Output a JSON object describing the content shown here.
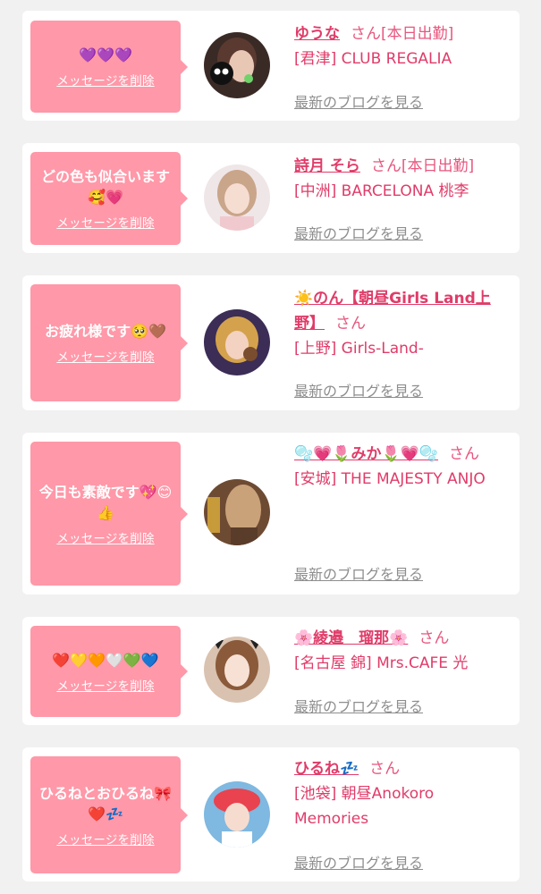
{
  "messages": [
    {
      "message": "💜💜💜",
      "delete_label": "メッセージを削除",
      "name": "ゆうな",
      "honorific": "さん",
      "status": "[本日出勤]",
      "shop": "[君津] CLUB REGALIA",
      "blog_link": "最新のブログを見る",
      "avatar_color": "#3a2a26"
    },
    {
      "message": "どの色も似合います🥰💗",
      "delete_label": "メッセージを削除",
      "name": "詩月 そら",
      "honorific": "さん",
      "status": "[本日出勤]",
      "shop": "[中洲] BARCELONA 桃李",
      "blog_link": "最新のブログを見る",
      "avatar_color": "#efe6e8"
    },
    {
      "message": "お疲れ様です🥺🤎",
      "delete_label": "メッセージを削除",
      "name": "☀️のん【朝昼Girls Land上野】",
      "honorific": "さん",
      "status": "",
      "shop": "[上野] Girls-Land-",
      "blog_link": "最新のブログを見る",
      "avatar_color": "#3b2d55"
    },
    {
      "message": "今日も素敵です💖😊👍",
      "delete_label": "メッセージを削除",
      "name": "🫧💗🌷みか🌷💗🫧",
      "honorific": "さん",
      "status": "",
      "shop": "[安城] THE MAJESTY ANJO",
      "blog_link": "最新のブログを見る",
      "avatar_color": "#6d4a32"
    },
    {
      "message": "❤️💛🧡🤍💚💙",
      "delete_label": "メッセージを削除",
      "name": "🌸綾邉　瑠那🌸",
      "honorific": "さん",
      "status": "",
      "shop": "[名古屋 錦] Mrs.CAFE 光",
      "blog_link": "最新のブログを見る",
      "avatar_color": "#d9c2b0"
    },
    {
      "message": "ひるねとおひるね🎀❤️💤",
      "delete_label": "メッセージを削除",
      "name": "ひるね💤",
      "honorific": "さん",
      "status": "",
      "shop": "[池袋] 朝昼Anokoro Memories",
      "blog_link": "最新のブログを見る",
      "avatar_color": "#7fb8e0"
    }
  ]
}
